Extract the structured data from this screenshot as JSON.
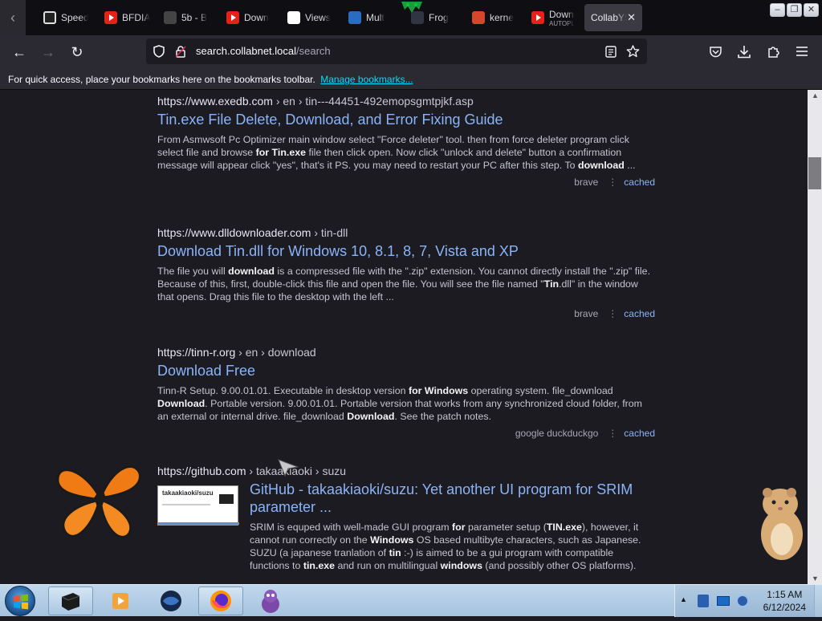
{
  "tabs": [
    {
      "title": "Speed",
      "icon": "speedometer-icon"
    },
    {
      "title": "BFDIA",
      "icon": "youtube-icon"
    },
    {
      "title": "5b - B",
      "icon": "document-icon"
    },
    {
      "title": "Down",
      "icon": "youtube-icon"
    },
    {
      "title": "Views",
      "icon": "github-icon"
    },
    {
      "title": "Mult",
      "icon": "bing-icon"
    },
    {
      "title": "Frog",
      "icon": "app-icon"
    },
    {
      "title": "kerne",
      "icon": "app-icon"
    },
    {
      "title": "Down",
      "subtitle": "AUTOPL",
      "icon": "youtube-icon"
    },
    {
      "title": "CollabYS",
      "icon": "collab-icon",
      "active": true
    }
  ],
  "navbar": {
    "back_label": "←",
    "forward_label": "→",
    "reload_label": "↻",
    "url_host": "search.collabnet.local",
    "url_path": "/search"
  },
  "bookmarks": {
    "text": "For quick access, place your bookmarks here on the bookmarks toolbar.",
    "link": "Manage bookmarks..."
  },
  "results": [
    {
      "url": "https://www.exedb.com",
      "path": " › en › tin---44451-492emopsgmtpjkf.asp",
      "title": "Tin.exe File Delete, Download, and Error Fixing Guide",
      "snippet_html": "From Asmwsoft Pc Optimizer main window select \"Force deleter\" tool. then from force deleter program click select file and browse <b>for Tin.exe</b> file then click open. Now click \"unlock and delete\" button a confirmation message will appear click \"yes\", that's it PS. you may need to restart your PC after this step. To <b>download</b> ...",
      "engines": "brave",
      "cached": "cached"
    },
    {
      "url": "https://www.dlldownloader.com",
      "path": " › tin-dll",
      "title": "Download Tin.dll for Windows 10, 8.1, 8, 7, Vista and XP",
      "snippet_html": "The file you will <b>download</b> is a compressed file with the \".zip\" extension. You cannot directly install the \".zip\" file. Because of this, first, double-click this file and open the file. You will see the file named \"<b>Tin</b>.dll\" in the window that opens. Drag this file to the desktop with the left ...",
      "engines": "brave",
      "cached": "cached"
    },
    {
      "url": "https://tinn-r.org",
      "path": " › en › download",
      "title": "Download Free",
      "snippet_html": "Tinn-R Setup. 9.00.01.01. Executable in desktop version <b>for Windows</b> operating system. file_download <b>Download</b>. Portable version. 9.00.01.01. Portable version that works from any synchronized cloud folder, from an external or internal drive. file_download <b>Download</b>. See the patch notes.",
      "engines": "google  duckduckgo",
      "cached": "cached"
    },
    {
      "url": "https://github.com",
      "path": " › takaakiaoki › suzu",
      "title": "GitHub - takaakiaoki/suzu: Yet another UI program for SRIM parameter ...",
      "thumb_label": "takaakiaoki/suzu",
      "snippet_html": "SRIM is equped with well-made GUI program <b>for</b> parameter setup (<b>TIN.exe</b>), however, it cannot run correctly on the <b>Windows</b> OS based multibyte characters, such as Japanese. SUZU (a japanese tranlation of <b>tin</b> :-) is aimed to be a gui program with compatible functions to <b>tin.exe</b> and run on multilingual <b>windows</b> (and possibly other OS platforms)."
    }
  ],
  "taskbar": {
    "time": "1:15 AM",
    "date": "6/12/2024"
  },
  "colors": {
    "page_bg": "#1c1b22",
    "link": "#8ab4f8",
    "toolbar_bg": "#2b2a33",
    "manage_link": "#00ddff"
  }
}
